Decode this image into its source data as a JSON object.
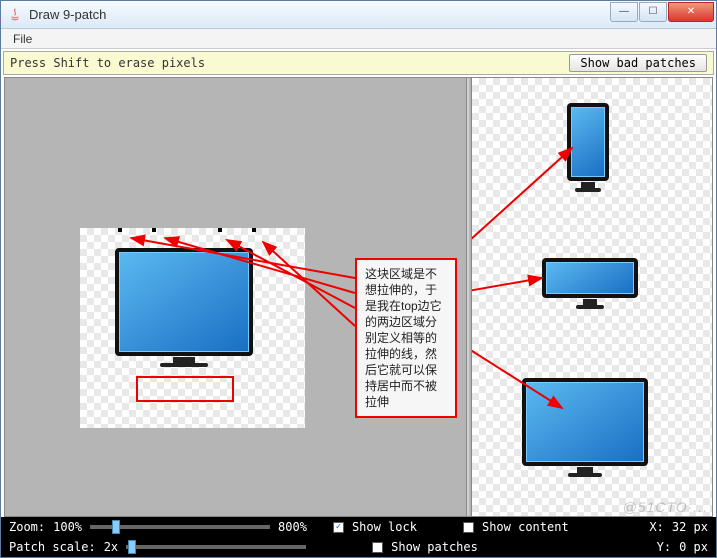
{
  "window": {
    "title": "Draw 9-patch",
    "buttons": {
      "min": "—",
      "max": "☐",
      "close": "✕"
    }
  },
  "menu": {
    "file": "File"
  },
  "toolbar": {
    "hint": "Press Shift to erase pixels",
    "show_bad_patches": "Show bad patches"
  },
  "annotation": {
    "text": "这块区域是不想拉伸的，于是我在top边它的两边区域分别定义相等的拉伸的线，然后它就可以保持居中而不被拉伸"
  },
  "status": {
    "zoom_label": "Zoom:",
    "zoom_value_left": "100%",
    "zoom_value_right": "800%",
    "show_lock": "Show lock",
    "show_content": "Show content",
    "x_label": "X:",
    "x_value": "32 px",
    "patch_scale_label": "Patch scale:",
    "patch_scale_value": "2x",
    "show_patches": "Show patches",
    "y_label": "Y:",
    "y_value": "0 px"
  },
  "checkboxes": {
    "show_lock": true,
    "show_content": false,
    "show_patches": false
  },
  "watermark": "@51CTO·..."
}
